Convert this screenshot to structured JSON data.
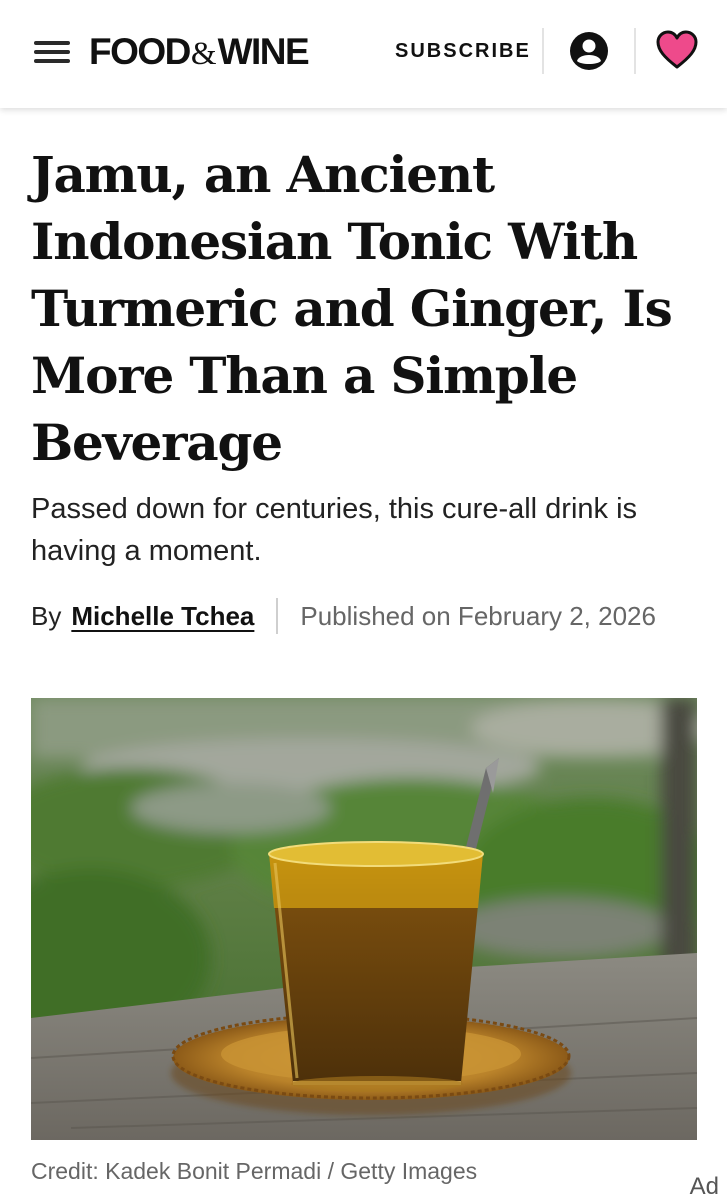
{
  "header": {
    "menu_icon": "hamburger-menu-icon",
    "logo": {
      "part1": "FOOD",
      "amp": "&",
      "part2": "WINE"
    },
    "subscribe_label": "SUBSCRIBE",
    "account_icon": "user-account-icon",
    "favorites_icon": "heart-icon",
    "favorites_color": "#ee4a8b"
  },
  "article": {
    "title": "Jamu, an Ancient Indonesian Tonic With Turmeric and Ginger, Is More Than a Simple Beverage",
    "subtitle": "Passed down for centuries, this cure-all drink is having a moment.",
    "byline": {
      "prefix": "By",
      "author": "Michelle Tchea",
      "published": "Published on February 2, 2026"
    },
    "image": {
      "credit": "Credit: Kadek Bonit Permadi / Getty Images"
    }
  },
  "ad_label": "Ad"
}
